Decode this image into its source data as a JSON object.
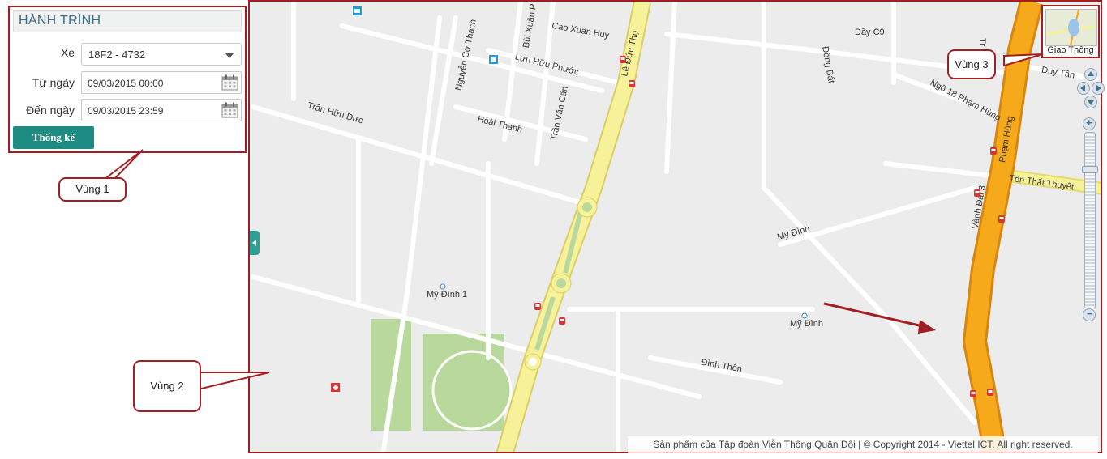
{
  "panel": {
    "title": "HÀNH TRÌNH",
    "vehicle_label": "Xe",
    "vehicle_value": "18F2 - 4732",
    "from_label": "Từ ngày",
    "from_value": "09/03/2015 00:00",
    "to_label": "Đến ngày",
    "to_value": "09/03/2015 23:59",
    "submit_label": "Thống kê"
  },
  "callouts": {
    "zone1": "Vùng 1",
    "zone2": "Vùng 2",
    "zone3": "Vùng 3"
  },
  "map": {
    "streets": {
      "tran_huu_duc": "Trần Hữu Dực",
      "nguyen_co_thach": "Nguyễn Cơ Thạch",
      "bui_xuan": "Bùi Xuân P",
      "cao_xuan_huy": "Cao Xuân Huy",
      "luu_huu_phuoc": "Lưu Hữu Phước",
      "hoai_thanh": "Hoài Thanh",
      "tran_van_can": "Trần Văn Cẩn",
      "le_duc_tho": "Lê Đức Thọ",
      "my_dinh_1": "Mỹ Đình 1",
      "my_dinh_road": "Mỹ Đình",
      "my_dinh_area": "Mỹ Đình",
      "dinh_thon": "Đình Thôn",
      "day_c9": "Dãy C9",
      "dong_bat": "Đồng Bát",
      "ngo_18": "Ngõ 18 Phạm Hùng",
      "duy_tan": "Duy Tân",
      "pham_hung": "Phạm Hùng",
      "ton_that_thuyet": "Tôn Thất Thuyết",
      "vanh_dai_3": "Vành Đai 3",
      "tr": "Tr"
    },
    "layer_thumb_label": "Giao Thông",
    "copyright": "Sản phẩm của Tập đoàn Viễn Thông Quân Đội | © Copyright 2014 - Viettel ICT. All right reserved.",
    "zoom_in": "+",
    "zoom_out": "−"
  },
  "colors": {
    "accent_border": "#a31e22",
    "button": "#1f8c83",
    "main_road": "#f7f29a",
    "highway": "#f7a91c",
    "park": "#b9d99c"
  }
}
